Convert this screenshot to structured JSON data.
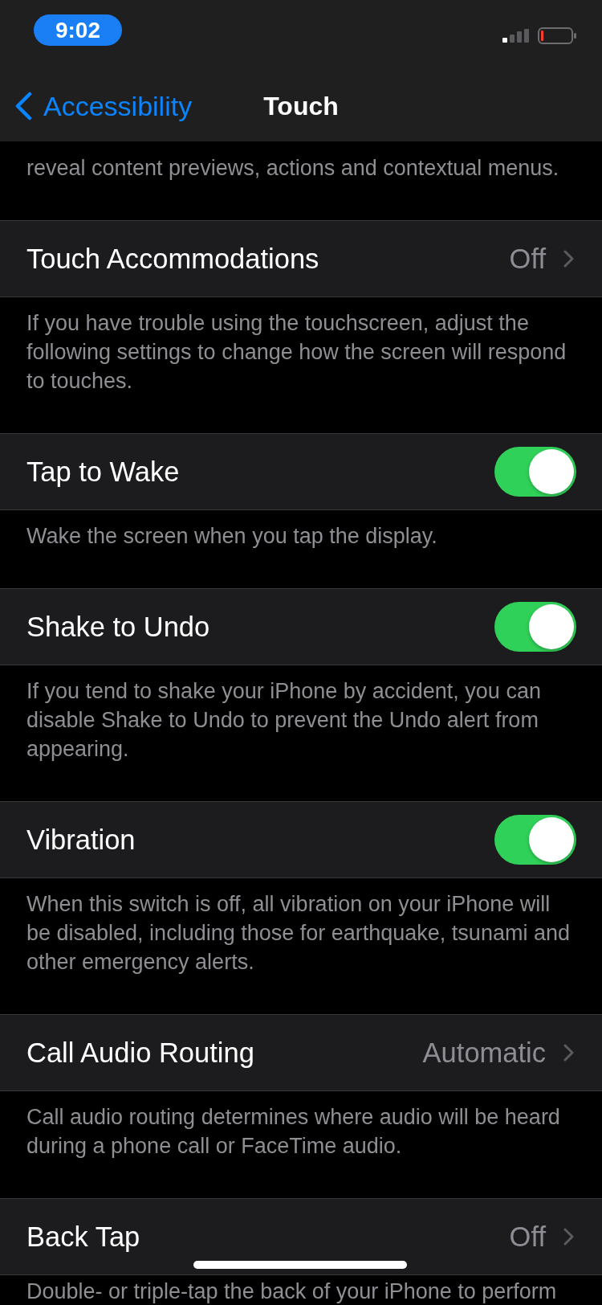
{
  "status_bar": {
    "time": "9:02"
  },
  "nav_bar": {
    "back_label": "Accessibility",
    "title": "Touch"
  },
  "leading_footer": "reveal content previews, actions and contextual menus.",
  "rows": [
    {
      "kind": "disclosure",
      "label": "Touch Accommodations",
      "value": "Off",
      "footer": "If you have trouble using the touchscreen, adjust the following settings to change how the screen will respond to touches."
    },
    {
      "kind": "toggle",
      "label": "Tap to Wake",
      "on": true,
      "footer": "Wake the screen when you tap the display."
    },
    {
      "kind": "toggle",
      "label": "Shake to Undo",
      "on": true,
      "footer": "If you tend to shake your iPhone by accident, you can disable Shake to Undo to prevent the Undo alert from appearing."
    },
    {
      "kind": "toggle",
      "label": "Vibration",
      "on": true,
      "footer": "When this switch is off, all vibration on your iPhone will be disabled, including those for earthquake, tsunami and other emergency alerts."
    },
    {
      "kind": "disclosure",
      "label": "Call Audio Routing",
      "value": "Automatic",
      "footer": "Call audio routing determines where audio will be heard during a phone call or FaceTime audio."
    },
    {
      "kind": "disclosure",
      "label": "Back Tap",
      "value": "Off",
      "footer": "Double- or triple-tap the back of your iPhone to perform"
    }
  ]
}
